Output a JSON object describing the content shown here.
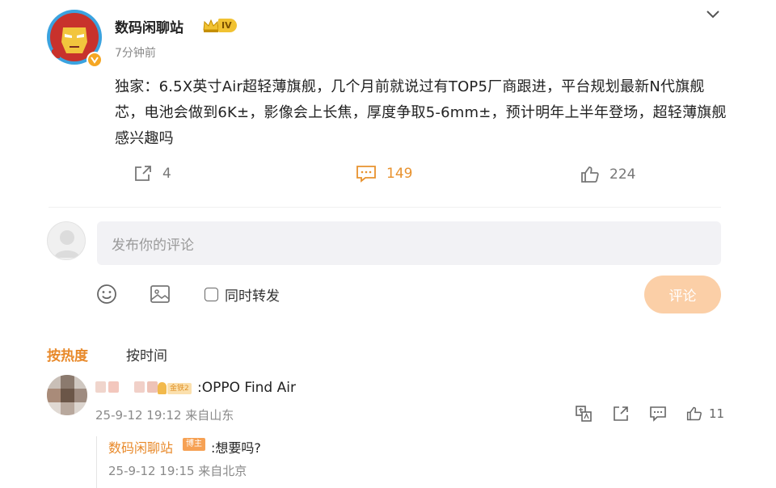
{
  "post": {
    "author_name": "数码闲聊站",
    "level_badge": "IV",
    "time": "7分钟前",
    "text": "独家：6.5X英寸Air超轻薄旗舰，几个月前就说过有TOP5厂商跟进，平台规划最新N代旗舰芯，电池会做到6K±，影像会上长焦，厚度争取5-6mm±，预计明年上半年登场，超轻薄旗舰感兴趣吗",
    "reposts": "4",
    "comments": "149",
    "likes": "224"
  },
  "composer": {
    "placeholder": "发布你的评论",
    "forward_label": "同时转发",
    "submit_label": "评论"
  },
  "sort_tabs": {
    "hot": "按热度",
    "time": "按时间"
  },
  "comments": [
    {
      "fan_badge": "金铁2",
      "text": ":OPPO Find Air",
      "meta": "25-9-12 19:12 来自山东",
      "likes": "11",
      "replies": [
        {
          "author": "数码闲聊站",
          "badge": "博主",
          "text": ":想要吗?",
          "meta": "25-9-12 19:15 来自北京"
        }
      ]
    }
  ],
  "colors": {
    "accent": "#e8892a",
    "submit_disabled": "#fbcfa7",
    "input_bg": "#f2f2f5"
  }
}
